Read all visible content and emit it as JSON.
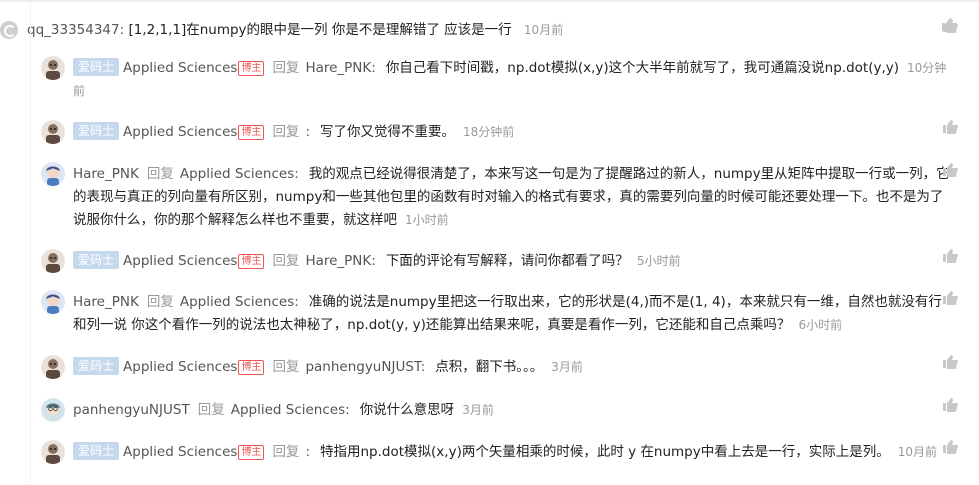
{
  "root": {
    "user": "qq_33354347:",
    "content": "[1,2,1,1]在numpy的眼中是一列 你是不是理解错了 应该是一行",
    "time": "10月前"
  },
  "labels": {
    "reply_word": "回复",
    "badge_code": "爱码士",
    "badge_bo": "博主"
  },
  "replies": [
    {
      "user": "Applied Sciences",
      "target": "Hare_PNK:",
      "content": "你自己看下时间戳，np.dot模拟(x,y)这个大半年前就写了，我可通篇没说np.dot(y,y)",
      "time": "10分钟前",
      "badge": true
    },
    {
      "user": "Applied Sciences",
      "target": ":",
      "content": "写了你又觉得不重要。",
      "time": "18分钟前",
      "badge": true
    },
    {
      "user": "Hare_PNK",
      "target": "Applied Sciences:",
      "content": "我的观点已经说得很清楚了，本来写这一句是为了提醒路过的新人，numpy里从矩阵中提取一行或一列，它的表现与真正的列向量有所区别，numpy和一些其他包里的函数有时对输入的格式有要求，真的需要列向量的时候可能还要处理一下。也不是为了说服你什么，你的那个解释怎么样也不重要，就这样吧",
      "time": "1小时前",
      "badge": false
    },
    {
      "user": "Applied Sciences",
      "target": "Hare_PNK:",
      "content": "下面的评论有写解释，请问你都看了吗？",
      "time": "5小时前",
      "badge": true
    },
    {
      "user": "Hare_PNK",
      "target": "Applied Sciences:",
      "content": "准确的说法是numpy里把这一行取出来，它的形状是(4,)而不是(1, 4)，本来就只有一维，自然也就没有行和列一说 你这个看作一列的说法也太神秘了，np.dot(y, y)还能算出结果来呢，真要是看作一列，它还能和自己点乘吗？",
      "time": "6小时前",
      "badge": false
    },
    {
      "user": "Applied Sciences",
      "target": "panhengyuNJUST:",
      "content": "点积，翻下书。。。",
      "time": "3月前",
      "badge": true
    },
    {
      "user": "panhengyuNJUST",
      "target": "Applied Sciences:",
      "content": "你说什么意思呀",
      "time": "3月前",
      "badge": false
    },
    {
      "user": "Applied Sciences",
      "target": ":",
      "content": "特指用np.dot模拟(x,y)两个矢量相乘的时候，此时 y 在numpy中看上去是一行，实际上是列。",
      "time": "10月前",
      "badge": true
    }
  ],
  "icons": {
    "like": "thumbs-up-icon",
    "avatar_root": "user-avatar",
    "avatar_applied": "applied-sciences-avatar",
    "avatar_hare": "hare-avatar",
    "avatar_panh": "panhengyu-avatar"
  },
  "colors": {
    "badge_bg": "#c6d8ee",
    "badge_bo": "#e55555",
    "muted": "#999999",
    "like_icon": "#c8c8c8"
  }
}
